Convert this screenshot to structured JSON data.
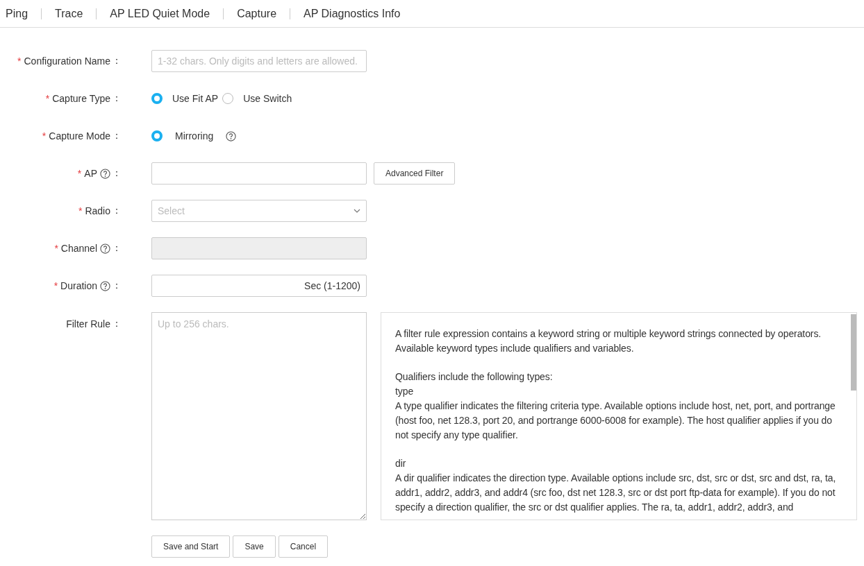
{
  "tabs": [
    {
      "label": "Ping"
    },
    {
      "label": "Trace"
    },
    {
      "label": "AP LED Quiet Mode"
    },
    {
      "label": "Capture"
    },
    {
      "label": "AP Diagnostics Info"
    }
  ],
  "form": {
    "fields": [
      {
        "kind": "text",
        "mark": "*",
        "label": "Configuration Name",
        "colon": "：",
        "placeholder": "1-32 chars. Only digits and letters are allowed."
      },
      {
        "kind": "radio",
        "mark": "*",
        "label": "Capture Type",
        "colon": "：",
        "options": [
          {
            "label": "Use Fit AP",
            "selected": true
          },
          {
            "label": "Use Switch",
            "selected": false
          }
        ]
      },
      {
        "kind": "radio",
        "mark": "*",
        "label": "Capture Mode",
        "colon": "：",
        "options": [
          {
            "label": "Mirroring",
            "selected": true,
            "help": true
          }
        ]
      },
      {
        "kind": "text",
        "mark": "*",
        "label": "AP",
        "help": true,
        "colon": "：",
        "button": "Advanced Filter"
      },
      {
        "kind": "select",
        "mark": "*",
        "label": "Radio",
        "colon": "：",
        "placeholder": "Select"
      },
      {
        "kind": "text",
        "mark": "*",
        "label": "Channel",
        "help": true,
        "colon": "：",
        "disabled": true
      },
      {
        "kind": "text",
        "mark": "*",
        "label": "Duration",
        "help": true,
        "colon": "：",
        "suffix": "Sec (1-1200)"
      },
      {
        "kind": "textarea",
        "label": "Filter Rule",
        "colon": "：",
        "placeholder": "Up to 256 chars.",
        "info": [
          [
            "A filter rule expression contains a keyword string or multiple keyword strings connected by operators. Available keyword types include qualifiers and variables."
          ],
          [
            "Qualifiers include the following types:",
            "type",
            "A type qualifier indicates the filtering criteria type. Available options include host, net, port, and portrange (host foo, net 128.3, port 20, and portrange 6000-6008 for example). The host qualifier applies if you do not specify any type qualifier."
          ],
          [
            "dir",
            "A dir qualifier indicates the direction type. Available options include src, dst, src or dst, src and dst, ra, ta, addr1, addr2, addr3, and addr4 (src foo, dst net 128.3, src or dst port ftp-data for example). If you do not specify a direction qualifier, the src or dst qualifier applies. The ra, ta, addr1, addr2, addr3, and"
          ]
        ]
      }
    ],
    "buttons": [
      "Save and Start",
      "Save",
      "Cancel"
    ]
  }
}
